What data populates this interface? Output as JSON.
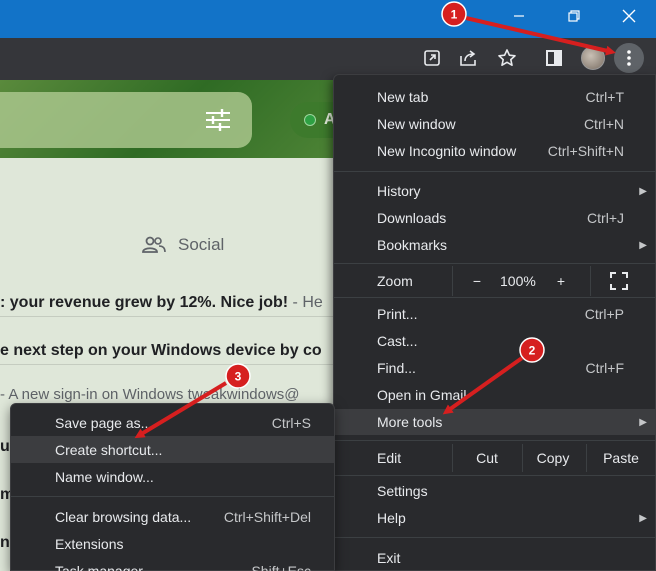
{
  "page_email": {
    "social_tab_label": "Social",
    "rows": [
      {
        "bold": ": your revenue grew by 12%. Nice job!",
        "snippet": " - He"
      },
      {
        "bold": "e next step on your Windows device by co",
        "snippet": ""
      },
      {
        "bold": "",
        "snippet": "- A new sign-in on Windows tweakwindows@"
      }
    ],
    "status_letter": "A",
    "left_chars": [
      "u",
      "m",
      "n"
    ]
  },
  "main_menu": {
    "items": [
      {
        "label": "New tab",
        "shortcut": "Ctrl+T"
      },
      {
        "label": "New window",
        "shortcut": "Ctrl+N"
      },
      {
        "label": "New Incognito window",
        "shortcut": "Ctrl+Shift+N"
      },
      {
        "label": "History",
        "shortcut": ""
      },
      {
        "label": "Downloads",
        "shortcut": "Ctrl+J"
      },
      {
        "label": "Bookmarks",
        "shortcut": ""
      },
      {
        "label": "Print...",
        "shortcut": "Ctrl+P"
      },
      {
        "label": "Cast...",
        "shortcut": ""
      },
      {
        "label": "Find...",
        "shortcut": "Ctrl+F"
      },
      {
        "label": "Open in Gmail",
        "shortcut": ""
      },
      {
        "label": "More tools",
        "shortcut": ""
      },
      {
        "label": "Settings",
        "shortcut": ""
      },
      {
        "label": "Help",
        "shortcut": ""
      },
      {
        "label": "Exit",
        "shortcut": ""
      }
    ],
    "zoom": {
      "label": "Zoom",
      "minus": "−",
      "value": "100%",
      "plus": "+"
    },
    "edit": {
      "label": "Edit",
      "cut": "Cut",
      "copy": "Copy",
      "paste": "Paste"
    }
  },
  "sub_menu": {
    "items": [
      {
        "label": "Save page as...",
        "shortcut": "Ctrl+S"
      },
      {
        "label": "Create shortcut...",
        "shortcut": ""
      },
      {
        "label": "Name window...",
        "shortcut": ""
      },
      {
        "label": "Clear browsing data...",
        "shortcut": "Ctrl+Shift+Del"
      },
      {
        "label": "Extensions",
        "shortcut": ""
      },
      {
        "label": "Task manager",
        "shortcut": "Shift+Esc"
      }
    ]
  },
  "annotations": {
    "badges": [
      "1",
      "2",
      "3"
    ],
    "color": "#d61f1f"
  },
  "colors": {
    "titlebar": "#1273c8",
    "toolbar": "#35363a",
    "menu_bg": "#292a2d",
    "menu_highlight": "#3c3d40",
    "page_bg": "#dfe7d9",
    "banner_green": "#2f6b24"
  },
  "icons": {
    "titlebar": [
      "minimize-icon",
      "restore-icon",
      "close-icon"
    ],
    "toolbar": [
      "open-in-app-icon",
      "share-icon",
      "bookmark-star-icon",
      "side-panel-icon",
      "profile-avatar",
      "three-dot-menu-icon"
    ],
    "page": [
      "filter-sliders-icon",
      "people-icon",
      "status-dot"
    ]
  }
}
